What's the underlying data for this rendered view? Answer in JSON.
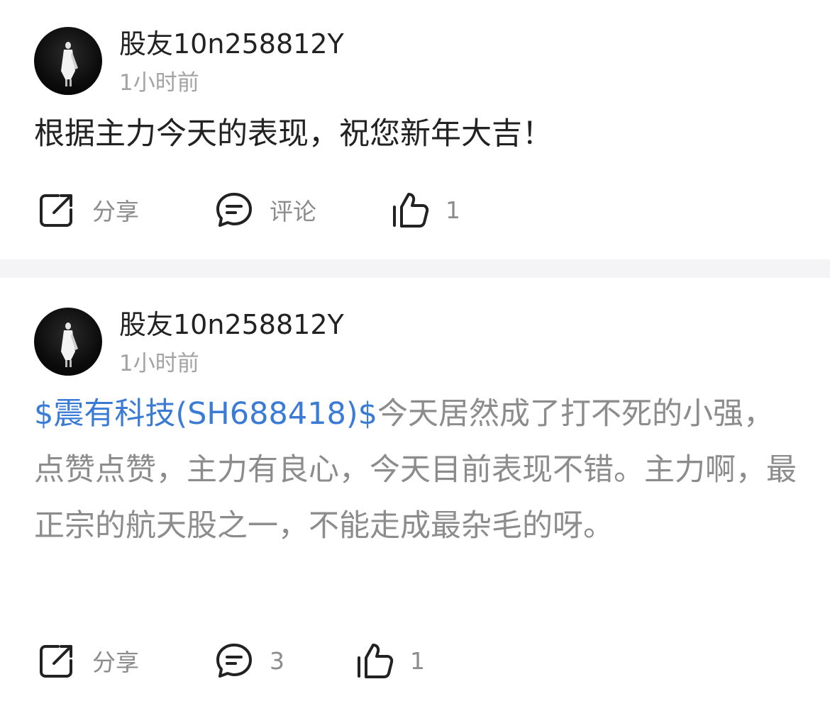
{
  "posts": [
    {
      "username": "股友10n258812Y",
      "time": "1小时前",
      "content": "根据主力今天的表现，祝您新年大吉！",
      "actions": {
        "share_label": "分享",
        "comment_label": "评论",
        "like_count": "1"
      }
    },
    {
      "username": "股友10n258812Y",
      "time": "1小时前",
      "stock_tag": "$震有科技(SH688418)$",
      "content": "今天居然成了打不死的小强，点赞点赞，主力有良心，今天目前表现不错。主力啊，最正宗的航天股之一，不能走成最杂毛的呀。",
      "actions": {
        "share_label": "分享",
        "comment_count": "3",
        "like_count": "1"
      }
    }
  ],
  "colors": {
    "link": "#3a7bd5",
    "secondary_text": "#8c8c8c",
    "divider": "#f4f4f6"
  },
  "icons": [
    "share-icon",
    "comment-icon",
    "thumbs-up-icon",
    "avatar-figure"
  ]
}
